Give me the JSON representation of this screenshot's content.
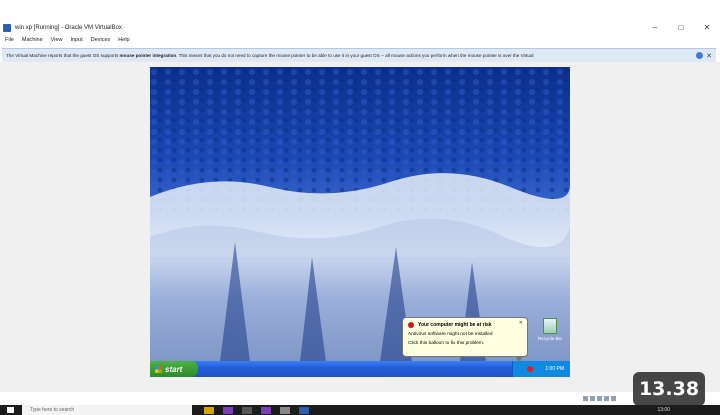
{
  "window": {
    "title": "win xp [Running] - Oracle VM VirtualBox",
    "controls": {
      "minimize": "–",
      "maximize": "□",
      "close": "✕"
    }
  },
  "menu": [
    "File",
    "Machine",
    "View",
    "Input",
    "Devices",
    "Help"
  ],
  "infobar": {
    "text_before": "The Virtual Machine reports that the guest OS supports ",
    "text_bold": "mouse pointer integration",
    "text_after": ". This means that you do not need to capture the mouse pointer to be able to use it in your guest OS -- all mouse actions you perform when the mouse pointer is over the Virtual"
  },
  "guest": {
    "start_label": "start",
    "clock": "1:00 PM",
    "recycle_bin": "Recycle Bin",
    "balloon": {
      "title": "Your computer might be at risk",
      "line1": "Antivirus software might not be installed",
      "line2": "Click this balloon to fix this problem."
    }
  },
  "host_taskbar": {
    "search_placeholder": "Type here to search",
    "time": "13:00"
  },
  "video_timestamp": "13.38",
  "colors": {
    "xp_taskbar": "#245edb",
    "start_green": "#3c9c37",
    "balloon_bg": "#ffffe1",
    "infobar_bg": "#dfe9f5"
  }
}
